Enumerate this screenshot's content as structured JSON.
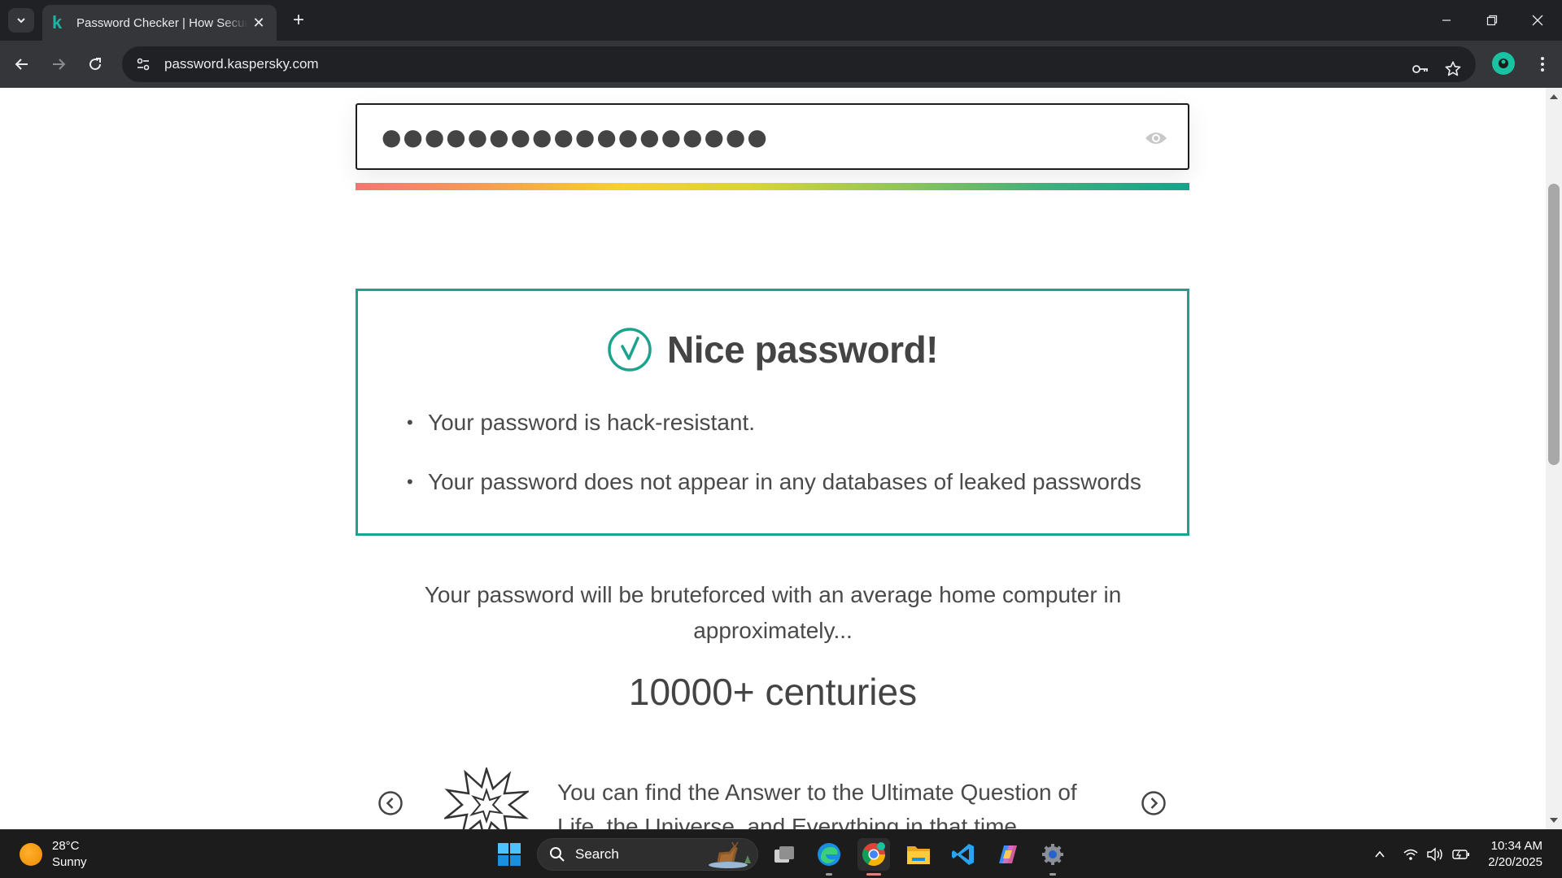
{
  "browser": {
    "tab_title": "Password Checker | How Secure Is My Password?",
    "tab_favicon": "k",
    "url": "password.kaspersky.com"
  },
  "page": {
    "password_mask": "●●●●●●●●●●●●●●●●●●",
    "result_title": "Nice password!",
    "bullets": [
      "Your password is hack-resistant.",
      "Your password does not appear in any databases of leaked passwords"
    ],
    "brute_text": "Your password will be bruteforced with an average home computer in approximately...",
    "brute_time": "10000+ centuries",
    "fact_text": "You can find the Answer to the Ultimate Question of Life, the Universe, and Everything in that time"
  },
  "taskbar": {
    "weather_temp": "28°C",
    "weather_desc": "Sunny",
    "search_label": "Search",
    "time": "10:34 AM",
    "date": "2/20/2025"
  },
  "colors": {
    "accent_teal": "#1ba38d",
    "browser_dark": "#202124",
    "browser_toolbar": "#35363a"
  }
}
